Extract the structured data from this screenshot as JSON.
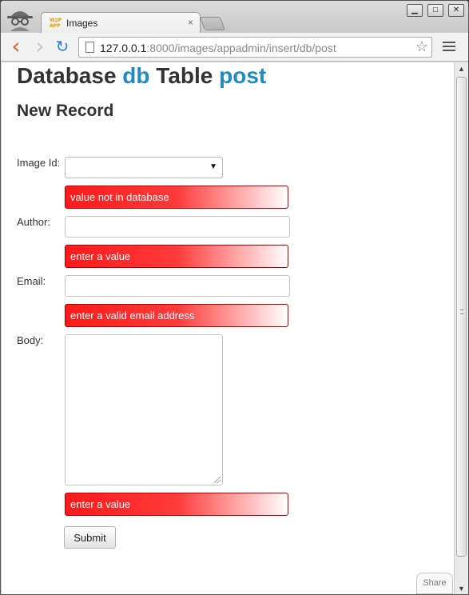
{
  "browser": {
    "tab_title": "Images",
    "tab_favicon_text": "W2P APP",
    "tab_close": "×",
    "window_buttons": {
      "minimize": "▁",
      "maximize": "□",
      "close": "✕"
    },
    "nav": {
      "back": "‹",
      "forward": "›",
      "reload": "↻"
    },
    "url_host": "127.0.0.1",
    "url_path": ":8000/images/appadmin/insert/db/post",
    "star": "☆"
  },
  "page": {
    "heading_database": "Database",
    "heading_db": "db",
    "heading_table": "Table",
    "heading_post": "post",
    "subheading": "New Record"
  },
  "form": {
    "image_id_label": "Image Id:",
    "image_id_value": "",
    "image_id_error": "value not in database",
    "author_label": "Author:",
    "author_value": "",
    "author_error": "enter a value",
    "email_label": "Email:",
    "email_value": "",
    "email_error": "enter a valid email address",
    "body_label": "Body:",
    "body_value": "",
    "body_error": "enter a value",
    "submit_label": "Submit"
  },
  "share_label": "Share",
  "colors": {
    "accent": "#1e8bc3",
    "error_red": "#ff1a1a"
  },
  "icons": [
    "incognito-icon",
    "page-icon",
    "star-icon",
    "menu-icon",
    "back-icon",
    "forward-icon",
    "reload-icon",
    "dropdown-arrow-icon"
  ]
}
